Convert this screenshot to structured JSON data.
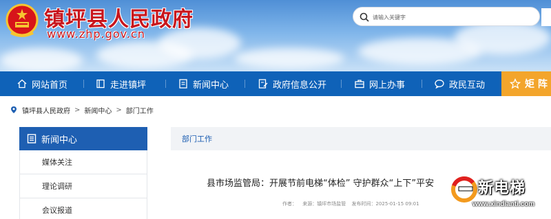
{
  "header": {
    "site_title": "镇坪县人民政府",
    "site_url": "www.zhp.gov.cn",
    "search_placeholder": "请输入关键字"
  },
  "nav": {
    "items": [
      {
        "label": "网站首页",
        "icon": "home-icon"
      },
      {
        "label": "走进镇坪",
        "icon": "book-icon"
      },
      {
        "label": "新闻中心",
        "icon": "document-icon"
      },
      {
        "label": "政府信息公开",
        "icon": "edit-document-icon"
      },
      {
        "label": "网上办事",
        "icon": "briefcase-icon"
      },
      {
        "label": "政民互动",
        "icon": "chat-icon"
      }
    ],
    "special": {
      "label": "矩 阵",
      "icon": "star-icon"
    }
  },
  "breadcrumb": {
    "icon": "location-pin-icon",
    "items": [
      "镇坪县人民政府",
      "新闻中心",
      "部门工作"
    ],
    "separator": ">"
  },
  "sidebar": {
    "title": "新闻中心",
    "items": [
      "媒体关注",
      "理论调研",
      "会议报道"
    ]
  },
  "main": {
    "section_title": "部门工作",
    "article_title": "县市场监管局：开展节前电梯“体检” 守护群众“上下”平安",
    "meta": {
      "author_label": "作者：",
      "source": "来源：镇坪市场监管",
      "published": "发布时间：2025-01-15 09:01"
    }
  },
  "watermark": {
    "text": "新电梯",
    "url": "www.xindianti.com"
  },
  "colors": {
    "nav_blue": "#0f62b8",
    "sidebar_blue": "#1e5fb2",
    "accent_orange": "#f3a52b",
    "title_red": "#c8161d"
  }
}
